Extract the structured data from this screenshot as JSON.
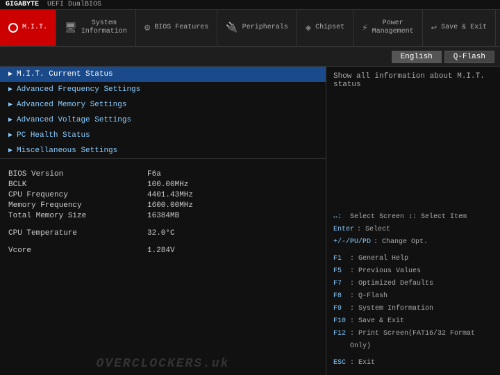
{
  "brand": "GIGABYTE",
  "bios_label": "UEFI DualBIOS",
  "nav": {
    "tabs": [
      {
        "id": "mit",
        "icon": "●",
        "label": "M.I.T.",
        "active": true
      },
      {
        "id": "system-info",
        "icon": "🖥",
        "label": "System\nInformation",
        "active": false
      },
      {
        "id": "bios-features",
        "icon": "⚙",
        "label": "BIOS\nFeatures",
        "active": false
      },
      {
        "id": "peripherals",
        "icon": "🔌",
        "label": "Peripherals",
        "active": false
      },
      {
        "id": "chipset",
        "icon": "⬡",
        "label": "Chipset",
        "active": false
      },
      {
        "id": "power-mgmt",
        "icon": "⚡",
        "label": "Power\nManagement",
        "active": false
      },
      {
        "id": "save-exit",
        "icon": "↩",
        "label": "Save & Exit",
        "active": false
      }
    ]
  },
  "lang_bar": {
    "english": "English",
    "qflash": "Q-Flash"
  },
  "menu": {
    "items": [
      {
        "label": "M.I.T. Current Status",
        "active": true
      },
      {
        "label": "Advanced Frequency Settings",
        "active": false
      },
      {
        "label": "Advanced Memory Settings",
        "active": false
      },
      {
        "label": "Advanced Voltage Settings",
        "active": false
      },
      {
        "label": "PC Health Status",
        "active": false
      },
      {
        "label": "Miscellaneous Settings",
        "active": false
      }
    ]
  },
  "info": {
    "rows": [
      {
        "label": "BIOS Version",
        "value": "F6a"
      },
      {
        "label": "BCLK",
        "value": "100.00MHz"
      },
      {
        "label": "CPU Frequency",
        "value": "4401.43MHz"
      },
      {
        "label": "Memory Frequency",
        "value": "1600.00MHz"
      },
      {
        "label": "Total Memory Size",
        "value": "16384MB"
      },
      {
        "label": "",
        "value": ""
      },
      {
        "label": "CPU Temperature",
        "value": "32.0°C"
      },
      {
        "label": "",
        "value": ""
      },
      {
        "label": "Vcore",
        "value": "1.284V"
      }
    ]
  },
  "watermark": "OVERCLOCKERS.uk",
  "right_panel": {
    "hint": "Show all information about M.I.T. status",
    "keys": [
      {
        "key": "↔:",
        "desc": "Select Screen  ↕: Select Item"
      },
      {
        "key": "Enter",
        "desc": ": Select"
      },
      {
        "key": "+/-/PU/PD",
        "desc": ": Change Opt."
      },
      {
        "key": "",
        "desc": ""
      },
      {
        "key": "F1",
        "desc": ": General Help"
      },
      {
        "key": "F5",
        "desc": ": Previous Values"
      },
      {
        "key": "F7",
        "desc": ": Optimized Defaults"
      },
      {
        "key": "F8",
        "desc": ": Q-Flash"
      },
      {
        "key": "F9",
        "desc": ": System Information"
      },
      {
        "key": "F10",
        "desc": ": Save & Exit"
      },
      {
        "key": "F12",
        "desc": ": Print Screen(FAT16/32 Format Only)"
      },
      {
        "key": "",
        "desc": ""
      },
      {
        "key": "ESC",
        "desc": ": Exit"
      }
    ]
  }
}
